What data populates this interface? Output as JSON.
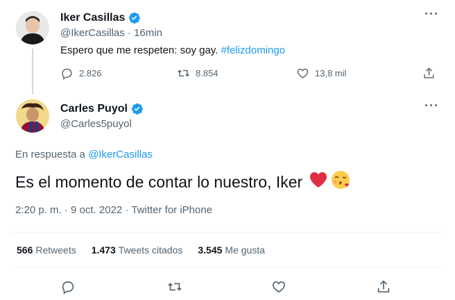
{
  "parent_tweet": {
    "author_name": "Iker Casillas",
    "handle": "@IkerCasillas",
    "time": "· 16min",
    "text": "Espero que me respeten: soy gay. ",
    "hashtag": "#felizdomingo",
    "replies": "2.826",
    "retweets": "8.854",
    "likes": "13,8 mil"
  },
  "main_tweet": {
    "author_name": "Carles Puyol",
    "handle": "@Carles5puyol",
    "reply_prefix": "En respuesta a ",
    "reply_mention": "@IkerCasillas",
    "text": "Es el momento de contar lo nuestro, Iker",
    "emojis": [
      "red-heart",
      "face-blowing-kiss"
    ],
    "timestamp": "2:20 p. m. · 9 oct. 2022 · Twitter for iPhone",
    "stats": {
      "retweets_count": "566",
      "retweets_label": "Retweets",
      "quotes_count": "1.473",
      "quotes_label": "Tweets citados",
      "likes_count": "3.545",
      "likes_label": "Me gusta"
    }
  },
  "colors": {
    "accent": "#1d9bf0",
    "muted": "#536471",
    "heart": "#e0245e"
  }
}
